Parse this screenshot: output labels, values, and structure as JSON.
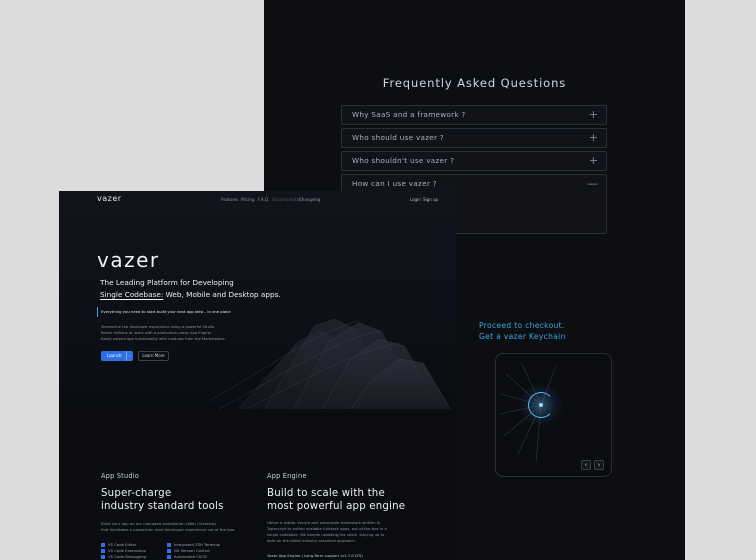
{
  "faq": {
    "title": "Frequently Asked Questions",
    "items": [
      {
        "question": "Why SaaS and a framework ?",
        "toggle": "+"
      },
      {
        "question": "Who should use vazer ?",
        "toggle": "+"
      },
      {
        "question": "Who shouldn't use vazer ?",
        "toggle": "+"
      },
      {
        "question": "How can I use vazer ?",
        "toggle": "—"
      }
    ]
  },
  "checkout": {
    "line1": "Proceed to checkout.",
    "line2": "Get a vazer Keychain",
    "prev": "‹",
    "next": "›"
  },
  "nav": {
    "logo": "vazer",
    "links": [
      "Features",
      "Pricing",
      "F.A.Q."
    ],
    "documentation": "Documentation",
    "changelog": "Changelog",
    "login": "Login",
    "signup": "Sign up"
  },
  "hero": {
    "logo": "vazer",
    "tagline1": "The Leading Platform for Developing",
    "tagline2_underlined": "Single Codebase:",
    "tagline2_rest": " Web, Mobile and Desktop apps.",
    "notice": "Everything you need to start build your next app idea – in one place",
    "desc_lines": [
      "Streamline the developer experience using a powerful Studio.",
      "Reach millions of users with a production-ready App Engine.",
      "Easily extend app functionality with modules from the Marketplace."
    ],
    "launch_label": "Launch",
    "launch_caret": "›",
    "learn_more_label": "Learn More"
  },
  "app_studio": {
    "label": "App Studio",
    "title_line1": "Super-charge",
    "title_line2": "industry standard tools",
    "desc_lines": [
      "Build your app on our managed workstation (Web / Desktop)",
      "that facilitates a production level developer experience out of the box."
    ],
    "features_left": [
      "VS Code Editor",
      "VS Code Extensions",
      "VS Code Debugging"
    ],
    "features_right": [
      "Integrated ZSH Terminal",
      "Git Version Control",
      "Automated CI/CD"
    ]
  },
  "app_engine": {
    "label": "App Engine",
    "title_line1": "Build to scale with the",
    "title_line2": "most powerful app engine",
    "desc_lines": [
      "Utilize a stable, secure and extensible framework written in",
      "Typescript to author scalable fullstack apps, out-of-the-box in a",
      "single codebase. We handle updating the stack, staying up to",
      "date on the latest industry standard approach."
    ],
    "support_line": "Vazer App Engine | Long-Term support (v1.7.0 LTS)"
  },
  "colors": {
    "accent": "#2f6fe6",
    "checkout_accent": "#3aa7e0",
    "background": "#0b0c10"
  }
}
